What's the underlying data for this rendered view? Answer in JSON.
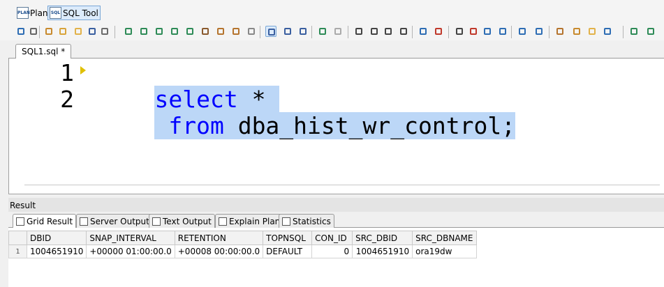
{
  "modes": [
    {
      "label": "Plan",
      "icon": "plan-icon",
      "icon_text": "PLAN"
    },
    {
      "label": "SQL Tool",
      "icon": "sql-icon",
      "icon_text": "SQL"
    }
  ],
  "editor": {
    "tab_label": "SQL1.sql *",
    "lines": [
      {
        "num": "1",
        "parts": [
          {
            "t": "select",
            "c": "kw"
          },
          {
            "t": " *",
            "c": "ident"
          }
        ]
      },
      {
        "num": "2",
        "parts": [
          {
            "t": " from",
            "c": "kw"
          },
          {
            "t": " dba_hist_wr_control;",
            "c": "ident"
          }
        ]
      }
    ]
  },
  "result": {
    "label": "Result",
    "tabs": [
      "Grid Result",
      "Server Output",
      "Text Output",
      "Explain Plan",
      "Statistics"
    ],
    "columns": [
      "DBID",
      "SNAP_INTERVAL",
      "RETENTION",
      "TOPNSQL",
      "CON_ID",
      "SRC_DBID",
      "SRC_DBNAME"
    ],
    "rows": [
      {
        "row_num": "1",
        "cells": [
          "1004651910",
          "+00000 01:00:00.0",
          "+00008 00:00:00.0",
          "DEFAULT",
          "0",
          "1004651910",
          "ora19dw"
        ]
      }
    ]
  },
  "colors": {
    "selection": "#bcd7f7",
    "keyword": "#0000ff",
    "active_tab_border": "#7aa7d6"
  }
}
